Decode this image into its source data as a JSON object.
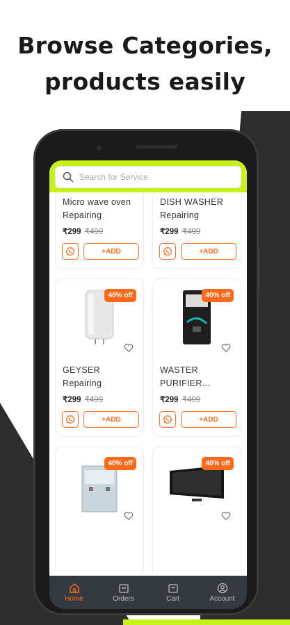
{
  "headline": {
    "line1": "Browse Categories,",
    "line2": "products easily"
  },
  "search": {
    "placeholder": "Search for Service"
  },
  "products": [
    {
      "name": "Micro wave oven Repairing",
      "price": "₹299",
      "mrp": "₹499",
      "badge": "",
      "add_label": "+ADD",
      "icon": "microwave-image"
    },
    {
      "name": "DISH WASHER Repairing",
      "price": "₹299",
      "mrp": "₹499",
      "badge": "",
      "add_label": "+ADD",
      "icon": "dishwasher-image"
    },
    {
      "name": "GEYSER Repairing",
      "price": "₹299",
      "mrp": "₹499",
      "badge": "40% off",
      "add_label": "+ADD",
      "icon": "geyser-image"
    },
    {
      "name": "WASTER PURIFIER...",
      "price": "₹299",
      "mrp": "₹499",
      "badge": "40% off",
      "add_label": "+ADD",
      "icon": "water-purifier-image"
    },
    {
      "name": "",
      "price": "",
      "mrp": "",
      "badge": "40% off",
      "add_label": "",
      "icon": "water-cooler-image"
    },
    {
      "name": "",
      "price": "",
      "mrp": "",
      "badge": "40% off",
      "add_label": "",
      "icon": "television-image"
    }
  ],
  "nav": [
    {
      "label": "Home",
      "icon": "home-icon",
      "active": true
    },
    {
      "label": "Orders",
      "icon": "orders-icon",
      "active": false
    },
    {
      "label": "Cart",
      "icon": "cart-icon",
      "active": false
    },
    {
      "label": "Account",
      "icon": "account-icon",
      "active": false
    }
  ],
  "colors": {
    "accent": "#ff6a1a",
    "brand_lime": "#c8f01a",
    "dark": "#2d2d2d",
    "nav_bg": "#343a40"
  }
}
